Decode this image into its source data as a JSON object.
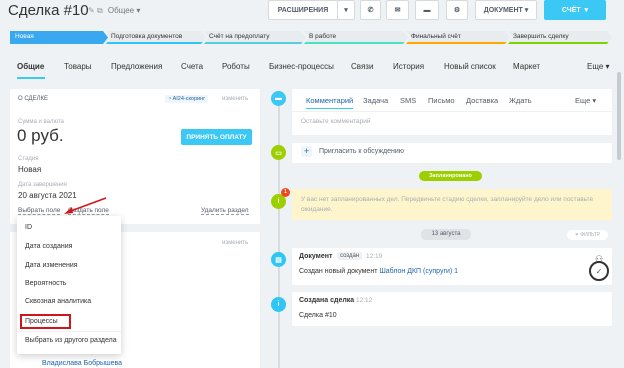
{
  "header": {
    "title": "Сделка #10",
    "title_dropdown": "Общее",
    "buttons": {
      "extensions": "РАСШИРЕНИЯ",
      "document": "ДОКУМЕНТ",
      "invoice": "СЧЁТ"
    }
  },
  "stages": [
    {
      "label": "Новая",
      "color": "#39a8ef",
      "active": true
    },
    {
      "label": "Подготовка документов",
      "color": "#2fc6f6"
    },
    {
      "label": "Счёт на предоплату",
      "color": "#55d0e0"
    },
    {
      "label": "В работе",
      "color": "#47e4c2"
    },
    {
      "label": "Финальный счёт",
      "color": "#ffa900"
    },
    {
      "label": "Завершить сделку",
      "color": "#7bd500"
    }
  ],
  "tabs": [
    "Общие",
    "Товары",
    "Предложения",
    "Счета",
    "Роботы",
    "Бизнес-процессы",
    "Связи",
    "История",
    "Новый список",
    "Маркет",
    "Еще"
  ],
  "deal_card": {
    "title": "О СДЕЛКЕ",
    "scoring_badge": "AI24-скоринг",
    "edit": "изменить",
    "amount_label": "Сумма и валюта",
    "amount": "0 руб.",
    "pay_button": "ПРИНЯТЬ ОПЛАТУ",
    "stage_label": "Стадия",
    "stage_value": "Новая",
    "end_date_label": "Дата завершения",
    "end_date_value": "20 августа 2021",
    "select_field": "Выбрать поле",
    "create_field": "Создать поле",
    "delete_section": "Удалить раздел"
  },
  "second_card": {
    "edit": "изменить",
    "user": "Владислава Бобрышева"
  },
  "dropdown": {
    "items": [
      "ID",
      "Дата создания",
      "Дата изменения",
      "Вероятность",
      "Сквозная аналитика",
      "Процессы",
      "Выбрать из другого раздела"
    ]
  },
  "composer": {
    "tabs": [
      "Комментарий",
      "Задача",
      "SMS",
      "Письмо",
      "Доставка",
      "Ждать",
      "Еще"
    ],
    "placeholder": "Оставьте комментарий"
  },
  "invite": {
    "text": "Пригласить к обсуждению"
  },
  "planned_badge": "Запланировано",
  "notice": {
    "text": "У вас нет запланированных дел. Передвиньте стадию сделки, запланируйте дело или поставьте ожидание.",
    "count": "1"
  },
  "date_separator": "13 августа",
  "filter": "ФИЛЬТР",
  "events": [
    {
      "title": "Документ",
      "badge": "создан",
      "time": "12:19",
      "body": "Создан новый документ ",
      "link": "Шаблон ДКП (супруги) 1"
    },
    {
      "title": "Создана сделка",
      "time": "12:12",
      "body": "Сделка #10"
    }
  ],
  "colors": {
    "accent": "#3bc8f5",
    "link": "#2066b0",
    "highlight": "#d0161c",
    "planned": "#9dcf00"
  }
}
